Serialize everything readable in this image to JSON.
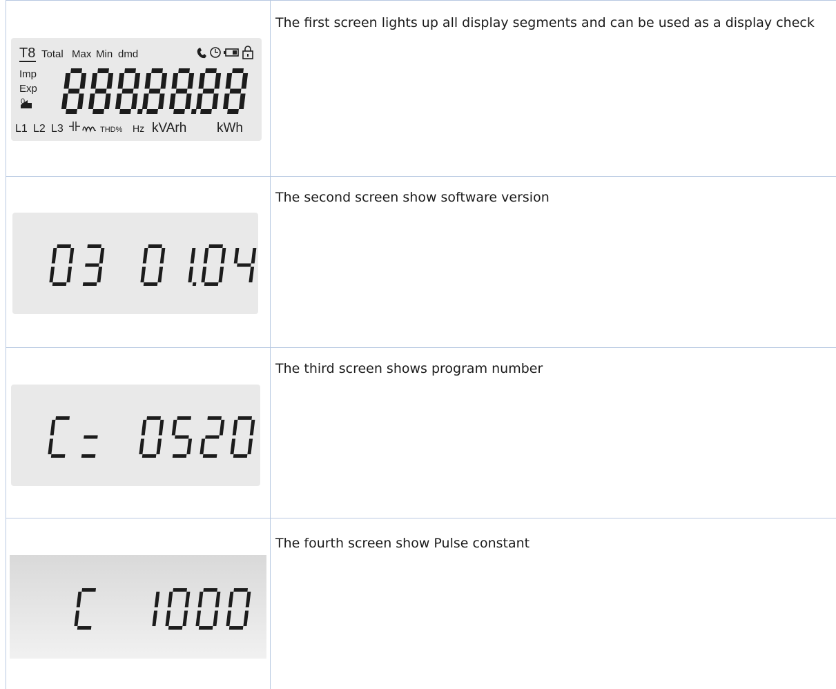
{
  "rows": [
    {
      "description": "The first screen lights up all display segments and can be used as a display check",
      "lcd": {
        "tariff": "T8",
        "top_labels": [
          "Total",
          "Max",
          "Min",
          "dmd"
        ],
        "side_labels": [
          "Imp",
          "Exp",
          "0"
        ],
        "digits": "888:88:88",
        "bottom_labels": [
          "L1",
          "L2",
          "L3",
          "THD%",
          "Hz",
          "kVArh",
          "kWh"
        ],
        "icons": [
          "phone-icon",
          "clock-icon",
          "battery-icon",
          "lock-icon",
          "return-arrow-icon",
          "capacitor-icon",
          "inductor-icon"
        ]
      }
    },
    {
      "description": "The second screen show software version",
      "lcd": {
        "digits": "03 01.04"
      }
    },
    {
      "description": "The third screen shows program number",
      "lcd": {
        "digits": "C= 0520"
      }
    },
    {
      "description": "The fourth screen show Pulse constant",
      "lcd": {
        "digits": "C 1000"
      }
    }
  ],
  "colors": {
    "lcd_background": "#e9e9e9",
    "segment": "#1c1c1c",
    "grid_line": "#b7c8e1"
  }
}
